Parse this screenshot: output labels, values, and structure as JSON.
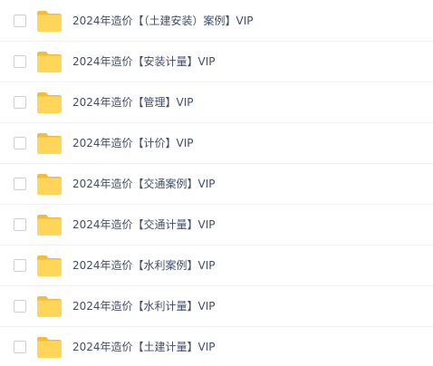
{
  "file_list": {
    "items": [
      {
        "name": "2024年造价【（土建安装）案例】VIP",
        "icon": "folder-icon",
        "selected": false
      },
      {
        "name": "2024年造价【安装计量】VIP",
        "icon": "folder-icon",
        "selected": false
      },
      {
        "name": "2024年造价【管理】VIP",
        "icon": "folder-icon",
        "selected": false
      },
      {
        "name": "2024年造价【计价】VIP",
        "icon": "folder-icon",
        "selected": false
      },
      {
        "name": "2024年造价【交通案例】VIP",
        "icon": "folder-icon",
        "selected": false
      },
      {
        "name": "2024年造价【交通计量】VIP",
        "icon": "folder-icon",
        "selected": false
      },
      {
        "name": "2024年造价【水利案例】VIP",
        "icon": "folder-icon",
        "selected": false
      },
      {
        "name": "2024年造价【水利计量】VIP",
        "icon": "folder-icon",
        "selected": false
      },
      {
        "name": "2024年造价【土建计量】VIP",
        "icon": "folder-icon",
        "selected": false
      }
    ]
  },
  "colors": {
    "folder_body": "#ffd659",
    "folder_tab": "#f5bd33",
    "text": "#424e67",
    "row_divider": "#f2f2f2",
    "checkbox_border": "#cfcfcf"
  }
}
